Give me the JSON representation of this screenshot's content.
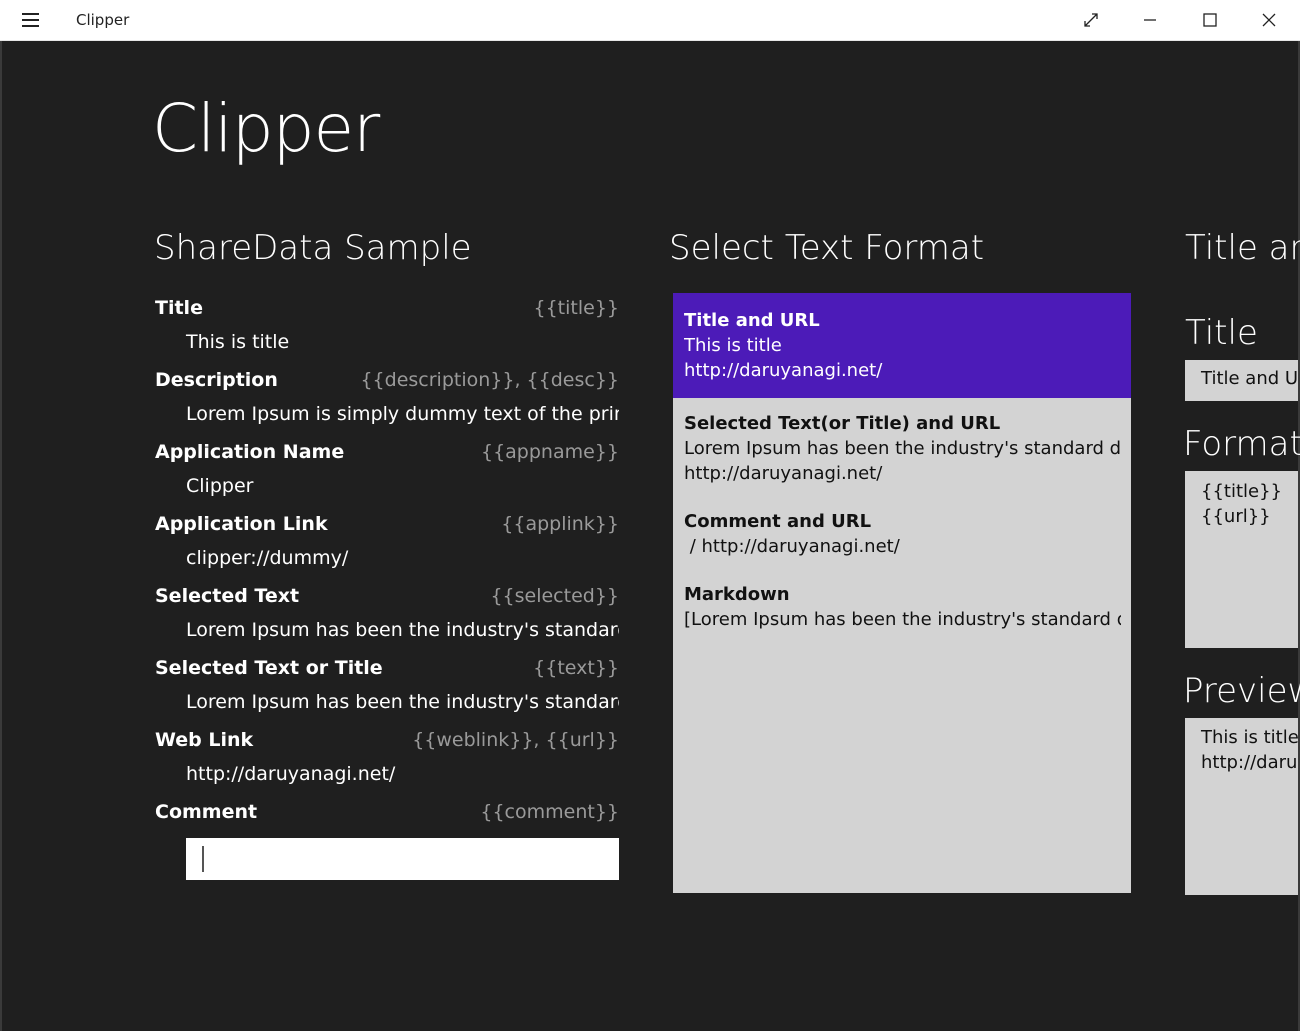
{
  "window": {
    "title": "Clipper"
  },
  "app": {
    "heading": "Clipper"
  },
  "share_data": {
    "heading": "ShareData Sample",
    "rows": [
      {
        "label": "Title",
        "token": "{{title}}",
        "value": "This is title"
      },
      {
        "label": "Description",
        "token": "{{description}}, {{desc}}",
        "value": "Lorem Ipsum is simply dummy text of the printi"
      },
      {
        "label": "Application Name",
        "token": "{{appname}}",
        "value": "Clipper"
      },
      {
        "label": "Application Link",
        "token": "{{applink}}",
        "value": "clipper://dummy/"
      },
      {
        "label": "Selected Text",
        "token": "{{selected}}",
        "value": "Lorem Ipsum has been the industry's standard c"
      },
      {
        "label": "Selected Text or Title",
        "token": "{{text}}",
        "value": "Lorem Ipsum has been the industry's standard c"
      },
      {
        "label": "Web Link",
        "token": "{{weblink}}, {{url}}",
        "value": "http://daruyanagi.net/"
      }
    ],
    "comment": {
      "label": "Comment",
      "token": "{{comment}}",
      "value": ""
    }
  },
  "text_format": {
    "heading": "Select Text Format",
    "items": [
      {
        "title": "Title and URL",
        "lines": [
          "This is title",
          "http://daruyanagi.net/"
        ],
        "selected": true
      },
      {
        "title": "Selected Text(or Title) and URL",
        "lines": [
          "Lorem Ipsum has been the industry's standard dumm",
          "http://daruyanagi.net/"
        ],
        "selected": false
      },
      {
        "title": "Comment and URL",
        "lines": [
          " / http://daruyanagi.net/"
        ],
        "selected": false
      },
      {
        "title": "Markdown",
        "lines": [
          "[Lorem Ipsum has been the industry's standard dumr"
        ],
        "selected": false
      }
    ]
  },
  "detail": {
    "heading": "Title and",
    "title_label": "Title",
    "title_value": "Title and UF",
    "format_label": "Format",
    "format_lines": [
      "{{title}}",
      "{{url}}"
    ],
    "preview_label": "Preview",
    "preview_lines": [
      "This is title",
      "http://daruy"
    ]
  },
  "colors": {
    "background": "#1f1f1f",
    "accent": "#4c1bb8",
    "panel": "#d3d3d3"
  }
}
